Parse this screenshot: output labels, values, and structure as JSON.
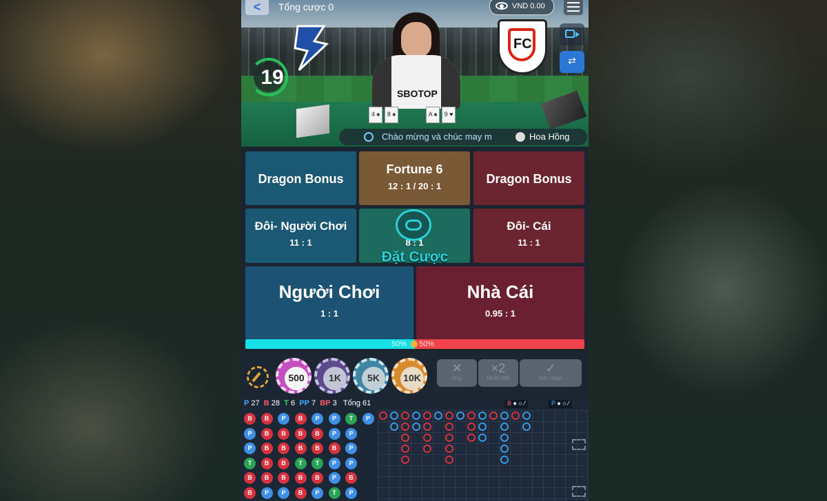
{
  "header": {
    "back_label": "<",
    "total_bet": "Tổng cược 0",
    "balance": "VND 0.00"
  },
  "video": {
    "timer": "19",
    "sponsor": "SBOTOP",
    "marquee": "Chào mừng và chúc may m",
    "dealer_name": "Hoa Hồng",
    "switch_icon": "⇄",
    "crest_letter": "FC",
    "cards": [
      "4 ♠",
      "8 ♠",
      "A ♠",
      "9 ♥"
    ]
  },
  "bets": {
    "dragon_bonus_player": "Dragon Bonus",
    "fortune6_name": "Fortune 6",
    "fortune6_odds": "12 : 1 / 20 : 1",
    "dragon_bonus_banker": "Dragon Bonus",
    "player_pair_name": "Đôi- Người Chơi",
    "player_pair_odds": "11 : 1",
    "tie_odds": "8 : 1",
    "banker_pair_name": "Đôi- Cái",
    "banker_pair_odds": "11 : 1",
    "deal_label": "Đặt Cược",
    "player_name": "Người Chơi",
    "player_odds": "1 : 1",
    "banker_name": "Nhà Cái",
    "banker_odds": "0.95 : 1"
  },
  "progress": {
    "player_pct": "50%",
    "banker_pct": "50%",
    "player_fraction": 0.5
  },
  "chips": [
    "500",
    "1K",
    "5K",
    "10K"
  ],
  "actions": {
    "cancel": "Hủy",
    "double": "Nhân Đôi",
    "double_icon": "×2",
    "confirm": "Xác nhận",
    "cancel_icon": "✕",
    "confirm_icon": "✓"
  },
  "stats": {
    "p_label": "P",
    "p": "27",
    "b_label": "B",
    "b": "28",
    "t_label": "T",
    "t": "6",
    "pp_label": "PP",
    "pp": "7",
    "bp_label": "BP",
    "bp": "3",
    "total": "Tổng 61"
  },
  "bead_road": [
    [
      "B",
      "P",
      "P",
      "T",
      "B",
      "B"
    ],
    [
      "B",
      "B",
      "B",
      "B",
      "B",
      "P"
    ],
    [
      "P",
      "B",
      "B",
      "B",
      "B",
      "P"
    ],
    [
      "B",
      "B",
      "B",
      "T",
      "B",
      "B"
    ],
    [
      "P",
      "B",
      "B",
      "T",
      "B",
      "P"
    ],
    [
      "P",
      "P",
      "B",
      "P",
      "P",
      "T"
    ],
    [
      "T",
      "P",
      "P",
      "P",
      "B",
      "P"
    ],
    [
      "P"
    ]
  ],
  "legend": {
    "banker": "B",
    "player": "P"
  },
  "colors": {
    "player": "#3f8fe6",
    "banker": "#d6333f",
    "tie": "#2aa355",
    "accent": "#2ad2d7"
  }
}
